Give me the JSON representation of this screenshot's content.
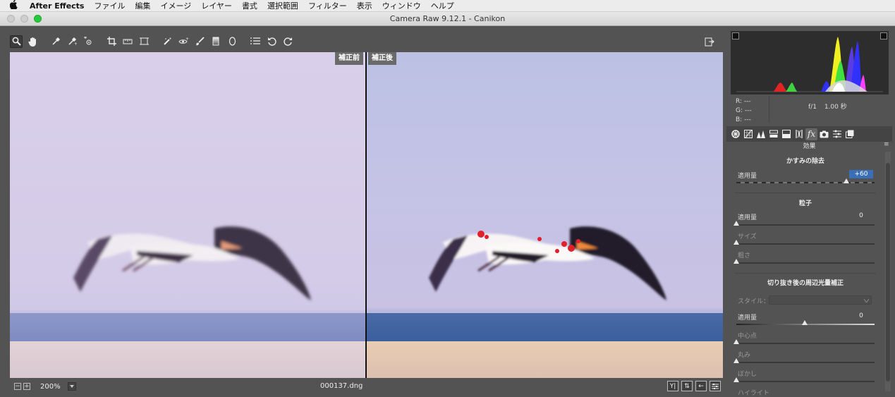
{
  "menubar": {
    "apple": "",
    "app": "After Effects",
    "items": [
      "ファイル",
      "編集",
      "イメージ",
      "レイヤー",
      "書式",
      "選択範囲",
      "フィルター",
      "表示",
      "ウィンドウ",
      "ヘルプ"
    ]
  },
  "window": {
    "title": "Camera Raw 9.12.1  -  Canikon"
  },
  "toolbar": {
    "tools": [
      "zoom-icon",
      "hand-icon",
      "white-balance-icon",
      "color-sampler-icon",
      "target-adjust-icon",
      "crop-icon",
      "straighten-icon",
      "transform-icon",
      "spot-removal-icon",
      "redeye-icon",
      "adjustment-brush-icon",
      "graduated-filter-icon",
      "radial-filter-icon",
      "presets-list-icon",
      "rotate-ccw-icon",
      "rotate-cw-icon"
    ]
  },
  "viewer": {
    "before_label": "補正前",
    "after_label": "補正後"
  },
  "status": {
    "zoom": "200%",
    "filename": "000137.dng"
  },
  "histogram": {
    "rgb": {
      "r": "R:  ---",
      "g": "G:  ---",
      "b": "B:  ---"
    },
    "aperture": "f/1",
    "shutter": "1.00 秒"
  },
  "panel": {
    "title": "効果",
    "dehaze": {
      "heading": "かすみの除去",
      "amount_label": "適用量",
      "amount_value": "+60",
      "amount_level": 0.8
    },
    "grain": {
      "heading": "粒子",
      "amount_label": "適用量",
      "amount_value": "0",
      "size_label": "サイズ",
      "roughness_label": "粗さ"
    },
    "vignette": {
      "heading": "切り抜き後の周辺光量補正",
      "style_label": "スタイル：",
      "amount_label": "適用量",
      "amount_value": "0",
      "midpoint_label": "中心点",
      "roundness_label": "丸み",
      "feather_label": "ぼかし",
      "highlights_label": "ハイライト"
    }
  },
  "colors": {
    "accent": "#3a6fb8",
    "panel_bg": "#535353",
    "sky_before": "#d9d0ec",
    "sky_after": "#b9bfe3",
    "sea_after": "#3f64a0",
    "sand_after": "#e6c9b0"
  }
}
